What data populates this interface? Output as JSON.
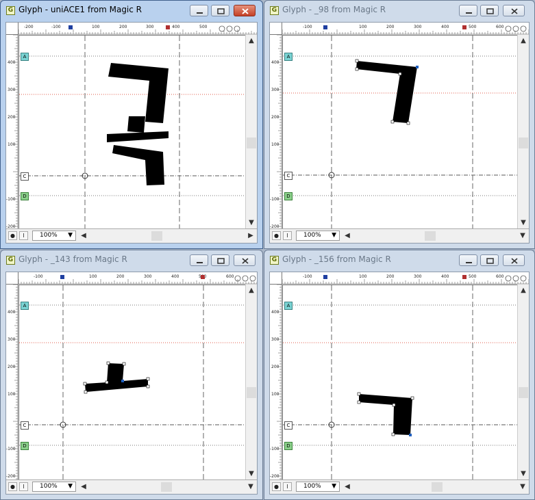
{
  "windows": [
    {
      "title": "Glyph - uniACE1 from Magic R",
      "active": true,
      "zoom": "100%",
      "ruler": {
        "h": [
          "-200",
          "-100",
          "100",
          "200",
          "300",
          "400",
          "500"
        ],
        "v": [
          "400",
          "300",
          "200",
          "100",
          "-100",
          "-200"
        ]
      },
      "markers": {
        "a": "A",
        "c": "C",
        "d": "D"
      },
      "scroll": {
        "left": "<",
        "right": ">",
        "up": "^",
        "down": "v"
      }
    },
    {
      "title": "Glyph - _98 from Magic R",
      "active": false,
      "zoom": "100%",
      "ruler": {
        "h": [
          "-100",
          "100",
          "200",
          "300",
          "400",
          "500",
          "600"
        ],
        "v": [
          "400",
          "300",
          "200",
          "100",
          "-100",
          "-200"
        ]
      },
      "markers": {
        "a": "A",
        "c": "C",
        "d": "D"
      },
      "scroll": {
        "left": "<",
        "right": ">",
        "up": "^",
        "down": "v"
      }
    },
    {
      "title": "Glyph - _143 from Magic R",
      "active": false,
      "zoom": "100%",
      "ruler": {
        "h": [
          "-100",
          "100",
          "200",
          "300",
          "400",
          "500",
          "600"
        ],
        "v": [
          "400",
          "300",
          "200",
          "100",
          "-100",
          "-200"
        ]
      },
      "markers": {
        "a": "A",
        "c": "C",
        "d": "D"
      },
      "scroll": {
        "left": "<",
        "right": ">",
        "up": "^",
        "down": "v"
      }
    },
    {
      "title": "Glyph - _156 from Magic R",
      "active": false,
      "zoom": "100%",
      "ruler": {
        "h": [
          "-100",
          "100",
          "200",
          "300",
          "400",
          "500",
          "600"
        ],
        "v": [
          "400",
          "300",
          "200",
          "100",
          "-100",
          "-200"
        ]
      },
      "markers": {
        "a": "A",
        "c": "C",
        "d": "D"
      },
      "scroll": {
        "left": "<",
        "right": ">",
        "up": "^",
        "down": "v"
      }
    }
  ],
  "icons": {
    "app": "glyph-app-icon",
    "lock": "lock-icon",
    "text_tool": "text-tool-icon",
    "minimize": "minimize-icon",
    "maximize": "maximize-icon",
    "close": "close-icon"
  },
  "colors": {
    "accent_blue": "#1f5fbf",
    "baseline": "#555555",
    "ascender": "#e05a4a",
    "marker_a": "#7ad3d3",
    "marker_d": "#8bd08b"
  }
}
